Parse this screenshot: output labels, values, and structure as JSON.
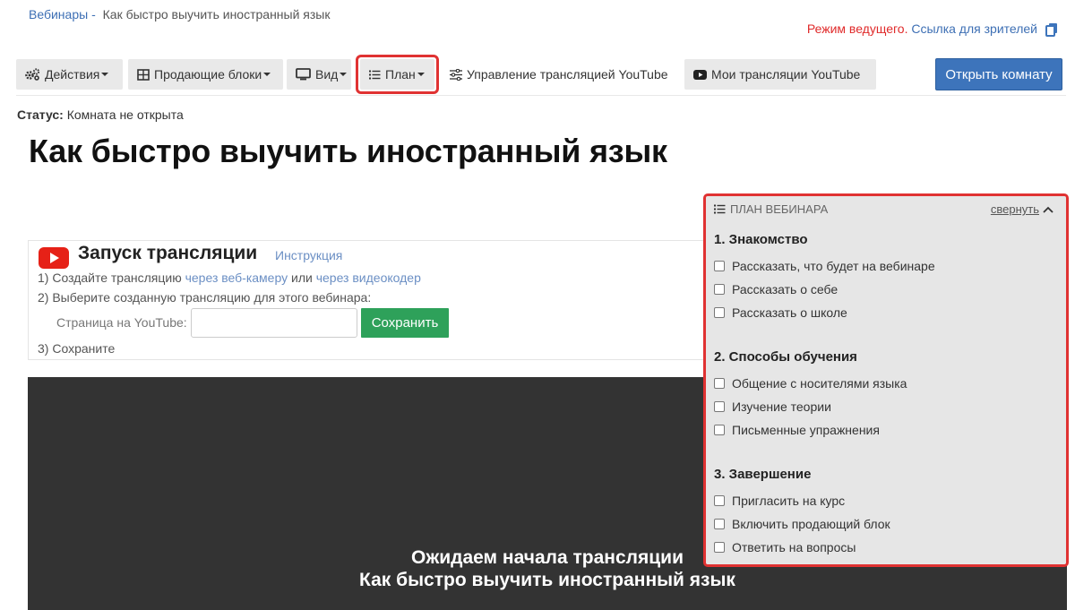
{
  "breadcrumb": {
    "root": "Вебинары",
    "separator": "-",
    "current": "Как быстро выучить иностранный язык"
  },
  "header": {
    "host_mode": "Режим ведущего.",
    "viewer_link": "Ссылка для зрителей"
  },
  "toolbar": {
    "actions": "Действия",
    "selling_blocks": "Продающие блоки",
    "view": "Вид",
    "plan": "План",
    "yt_manage": "Управление трансляцией YouTube",
    "my_streams": "Мои трансляции YouTube",
    "open_room": "Открыть комнату"
  },
  "status": {
    "label": "Статус:",
    "value": "Комната не открыта"
  },
  "page_title": "Как быстро выучить иностранный язык",
  "broadcast": {
    "title": "Запуск трансляции",
    "instruction": "Инструкция",
    "step1_prefix": "1) Создайте трансляцию",
    "step1_link1": "через веб-камеру",
    "step1_or": "или",
    "step1_link2": "через видеокодер",
    "step2": "2) Выберите созданную трансляцию для этого вебинара:",
    "yt_page_label": "Страница на YouTube:",
    "yt_input_value": "",
    "save": "Сохранить",
    "step3": "3) Сохраните"
  },
  "player": {
    "line1": "Ожидаем начала трансляции",
    "line2": "Как быстро выучить иностранный язык"
  },
  "plan": {
    "heading": "ПЛАН ВЕБИНАРА",
    "collapse": "свернуть",
    "sections": [
      {
        "title": "1. Знакомство",
        "items": [
          "Рассказать, что будет на вебинаре",
          "Рассказать о себе",
          "Рассказать о школе"
        ]
      },
      {
        "title": "2. Способы обучения",
        "items": [
          "Общение с носителями языка",
          "Изучение теории",
          "Письменные упражнения"
        ]
      },
      {
        "title": "3. Завершение",
        "items": [
          "Пригласить на курс",
          "Включить продающий блок",
          "Ответить на вопросы"
        ]
      }
    ]
  },
  "colors": {
    "accent_blue": "#3d74bb",
    "save_green": "#2ea15a",
    "highlight_red": "#e03232",
    "player_bg": "#333333"
  },
  "icons": [
    "gears-icon",
    "grid-icon",
    "monitor-icon",
    "list-icon",
    "sliders-icon",
    "youtube-icon",
    "copy-icon",
    "chevron-up-icon"
  ]
}
